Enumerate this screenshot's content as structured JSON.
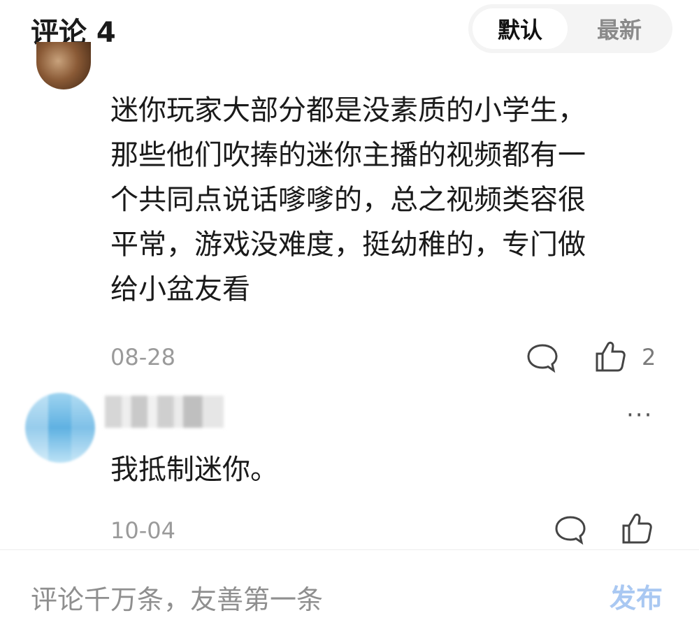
{
  "header": {
    "title": "评论 4",
    "sort_options": [
      "默认",
      "最新"
    ],
    "sort_selected": "默认"
  },
  "comments": [
    {
      "text_lines": [
        "迷你玩家大部分都是没素质的小学生，",
        "那些他们吹捧的迷你主播的视频都有一",
        "个共同点说话嗲嗲的，总之视频类容很",
        "平常，游戏没难度，挺幼稚的，专门做",
        "给小盆友看"
      ],
      "date": "08-28",
      "like_count": "2",
      "icons": [
        "reply-bubble-icon",
        "thumbs-up-icon"
      ]
    },
    {
      "text": "我抵制迷你。",
      "date": "10-04",
      "more_label": "···",
      "icons": [
        "reply-bubble-icon",
        "thumbs-up-icon",
        "more-dots-icon"
      ]
    }
  ],
  "input_bar": {
    "placeholder": "评论千万条，友善第一条",
    "publish_label": "发布",
    "publish_color": "#a9c8f2"
  }
}
